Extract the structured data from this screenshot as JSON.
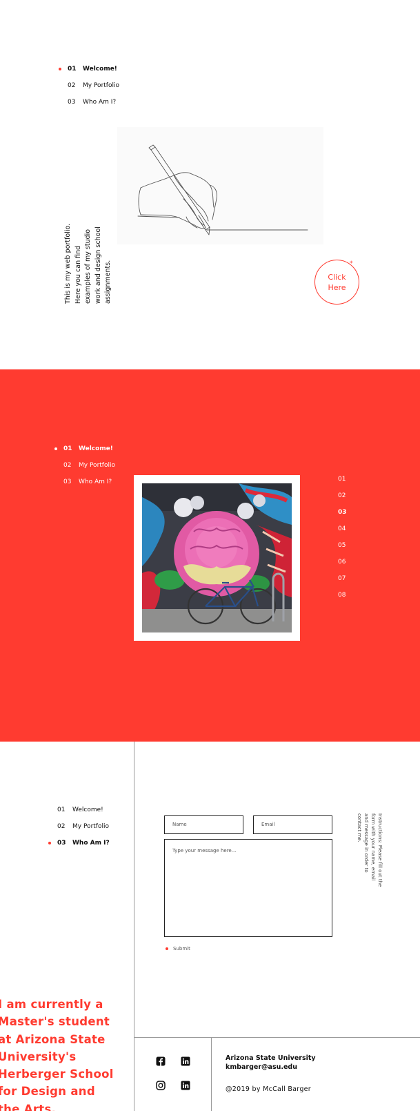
{
  "nav": {
    "items": [
      {
        "num": "01",
        "label": "Welcome!"
      },
      {
        "num": "02",
        "label": "My Portfolio"
      },
      {
        "num": "03",
        "label": "Who Am  I?"
      }
    ]
  },
  "welcome": {
    "intro_text": "This is my web portfolio. Here you can find examples of my studio work and design school assignments.",
    "cta_label_line1": "Click",
    "cta_label_line2": "Here",
    "cta_mark": "*",
    "hero_icon": "hand-drawing-pencil-illustration"
  },
  "portfolio": {
    "pager": [
      "01",
      "02",
      "03",
      "04",
      "05",
      "06",
      "07",
      "08"
    ],
    "active_page": "03",
    "image_subject": "street-mural-flower-and-bicycle"
  },
  "contact": {
    "name_placeholder": "Name",
    "email_placeholder": "Email",
    "message_placeholder": "Type your message here...",
    "submit_label": "Submit",
    "instructions": "Instructions: Please fill out the form with your name, email and message in order to contact me."
  },
  "about": {
    "bio": "I am currently a Master's student at Arizona State University's Herberger School for Design and the Arts."
  },
  "footer": {
    "org": "Arizona State University",
    "email": "kmbarger@asu.edu",
    "copyright": "@2019 by McCall Barger",
    "social_icons": [
      "facebook-icon",
      "linkedin-icon",
      "instagram-icon",
      "linkedin-icon"
    ]
  },
  "colors": {
    "accent": "#ff3b30",
    "text": "#111111",
    "background": "#ffffff"
  }
}
